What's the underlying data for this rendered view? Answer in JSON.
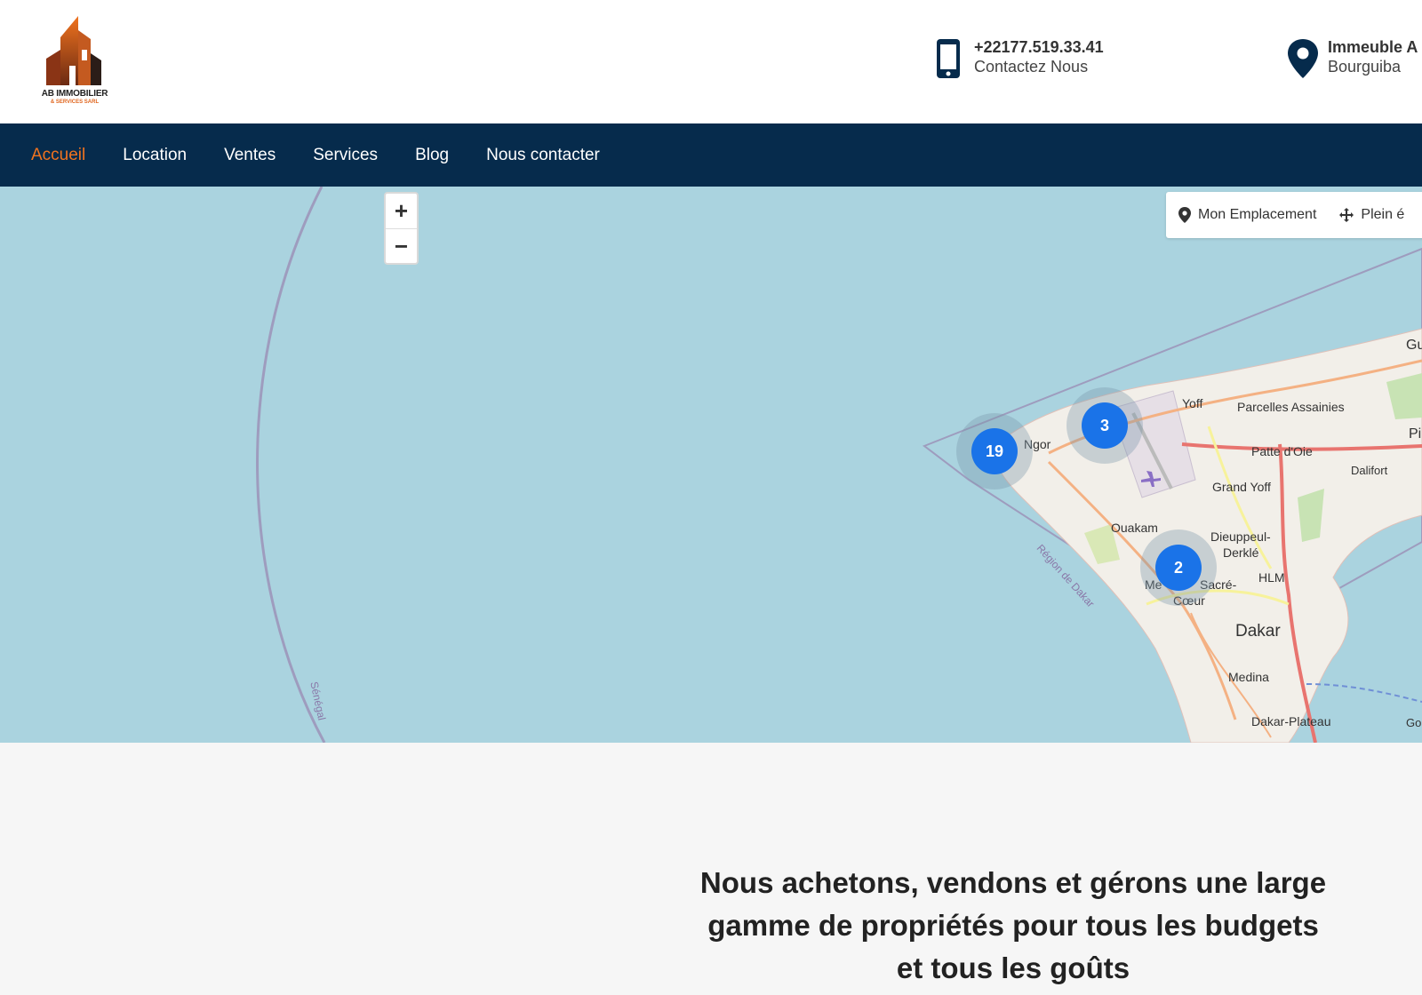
{
  "brand": {
    "name_line1": "AB IMMOBILIER",
    "name_line2": "& SERVICES SARL"
  },
  "contact_phone": {
    "number": "+22177.519.33.41",
    "label": "Contactez Nous"
  },
  "contact_address": {
    "line1": "Immeuble A",
    "line2": "Bourguiba"
  },
  "nav": {
    "items": [
      {
        "label": "Accueil",
        "active": true
      },
      {
        "label": "Location"
      },
      {
        "label": "Ventes"
      },
      {
        "label": "Services"
      },
      {
        "label": "Blog"
      },
      {
        "label": "Nous contacter"
      }
    ]
  },
  "map": {
    "zoom_in": "+",
    "zoom_out": "−",
    "tools": {
      "my_location": "Mon Emplacement",
      "fullscreen": "Plein é"
    },
    "clusters": [
      {
        "count": "19"
      },
      {
        "count": "3"
      },
      {
        "count": "2"
      }
    ],
    "places": {
      "yoff": "Yoff",
      "parcelles": "Parcelles Assainies",
      "ngor": "Ngor",
      "patte": "Patte d'Oie",
      "dalifort": "Dalifort",
      "grand_yoff": "Grand Yoff",
      "ouakam": "Ouakam",
      "dieuppeul": "Dieuppeul-",
      "derkle": "Derklé",
      "hlm": "HLM",
      "sacre": "Sacré-",
      "coeur": "Cœur",
      "me": "Me",
      "dakar": "Dakar",
      "medina": "Medina",
      "plateau": "Dakar-Plateau",
      "region": "Région de Dakar",
      "senegal": "Sénégal",
      "gu": "Gu",
      "pi": "Pi",
      "go": "Go"
    },
    "colors": {
      "water": "#aad3df",
      "land": "#f2efe9",
      "cluster": "#1a73e8"
    }
  },
  "headline": {
    "line1": "Nous achetons, vendons et gérons une large",
    "line2": "gamme de propriétés pour tous les budgets",
    "line3": "et tous les goûts"
  }
}
